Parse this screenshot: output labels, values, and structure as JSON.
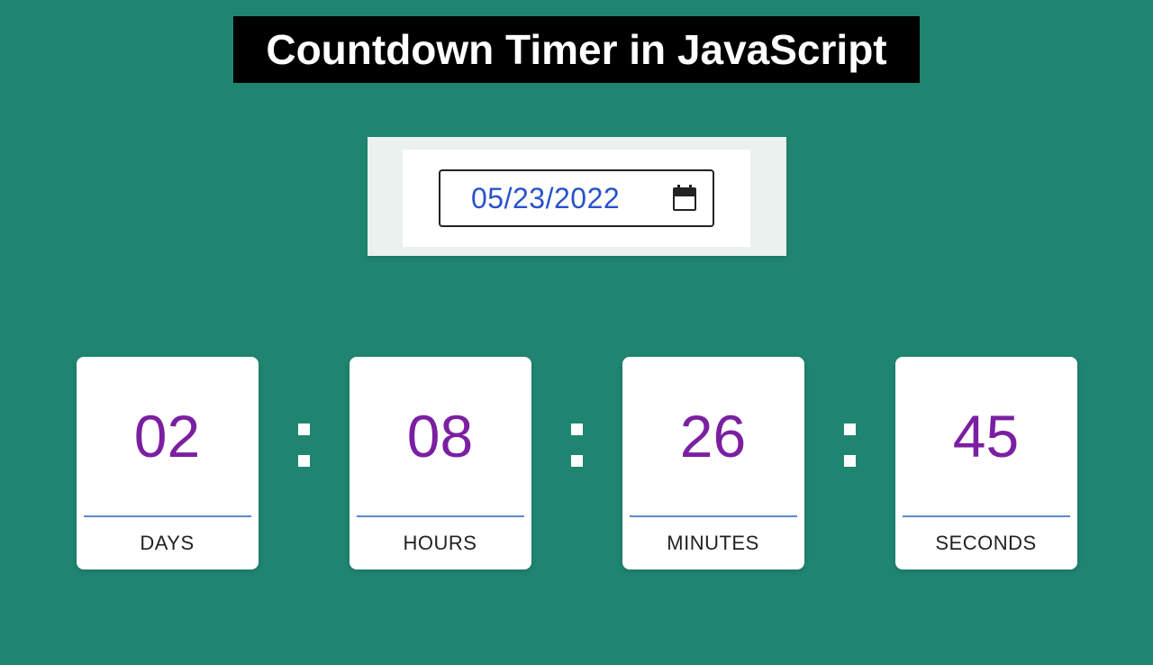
{
  "header": {
    "title": "Countdown Timer in JavaScript"
  },
  "dateInput": {
    "value": "05/23/2022"
  },
  "countdown": {
    "days": {
      "value": "02",
      "label": "DAYS"
    },
    "hours": {
      "value": "08",
      "label": "HOURS"
    },
    "minutes": {
      "value": "26",
      "label": "MINUTES"
    },
    "seconds": {
      "value": "45",
      "label": "SECONDS"
    }
  }
}
